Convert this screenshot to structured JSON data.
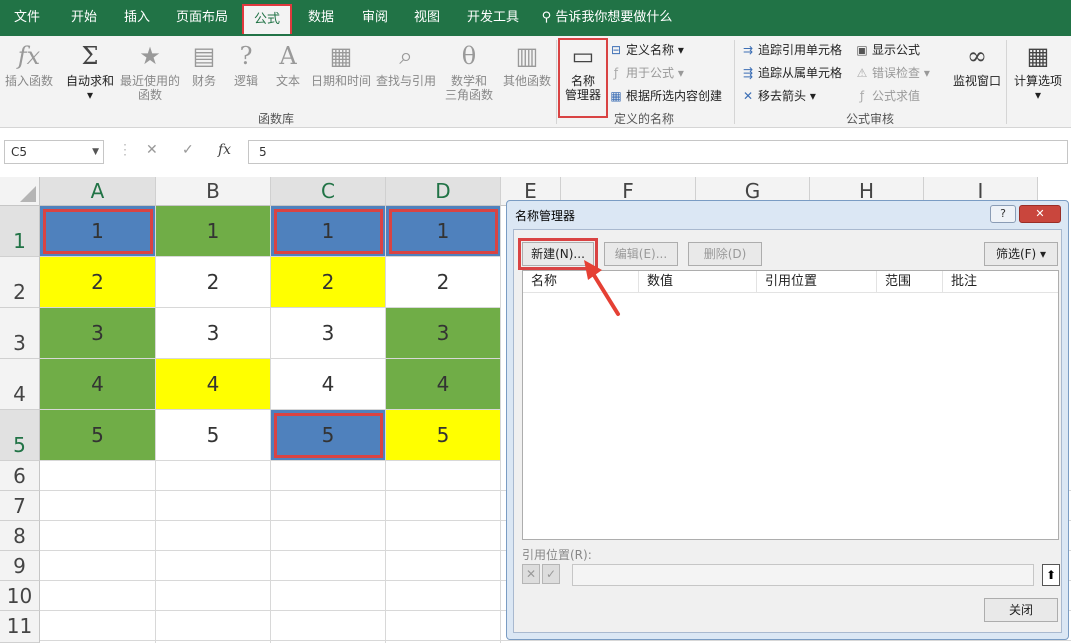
{
  "tabs": [
    "文件",
    "开始",
    "插入",
    "页面布局",
    "公式",
    "数据",
    "审阅",
    "视图",
    "开发工具"
  ],
  "tell_me": "告诉我你想要做什么",
  "ribbon": {
    "function_library": {
      "group_label": "函数库",
      "insert_function": "插入函数",
      "autosum": "自动求和",
      "recent": "最近使用的\n函数",
      "financial": "财务",
      "logical": "逻辑",
      "text": "文本",
      "datetime": "日期和时间",
      "lookup": "查找与引用",
      "math_l1": "数学和",
      "math_l2": "三角函数",
      "more": "其他函数"
    },
    "defined_names": {
      "group_label": "定义的名称",
      "name_manager_l1": "名称",
      "name_manager_l2": "管理器",
      "define_name": "定义名称",
      "use_in_formula": "用于公式",
      "create_from_selection": "根据所选内容创建"
    },
    "formula_auditing": {
      "group_label": "公式审核",
      "trace_precedents": "追踪引用单元格",
      "trace_dependents": "追踪从属单元格",
      "remove_arrows": "移去箭头",
      "show_formulas": "显示公式",
      "error_checking": "错误检查",
      "evaluate_formula": "公式求值"
    },
    "watch_window": "监视窗口",
    "calc_options": "计算选项"
  },
  "formula_bar": {
    "name_box": "C5",
    "fx": "fx",
    "value": "5"
  },
  "columns": [
    "A",
    "B",
    "C",
    "D",
    "E",
    "F",
    "G",
    "H",
    "I"
  ],
  "rows": [
    "1",
    "2",
    "3",
    "4",
    "5",
    "6",
    "7",
    "8",
    "9",
    "10",
    "11"
  ],
  "cells": [
    [
      "1",
      "1",
      "1",
      "1"
    ],
    [
      "2",
      "2",
      "2",
      "2"
    ],
    [
      "3",
      "3",
      "3",
      "3"
    ],
    [
      "4",
      "4",
      "4",
      "4"
    ],
    [
      "5",
      "5",
      "5",
      "5"
    ]
  ],
  "colors": {
    "green": "#70ad47",
    "yellow": "#ffff00",
    "blue": "#4f81bd",
    "white": "#ffffff",
    "highlight": "#d94343"
  },
  "dialog": {
    "title": "名称管理器",
    "help": "?",
    "close_x": "✕",
    "new_btn": "新建(N)...",
    "edit_btn": "编辑(E)...",
    "delete_btn": "删除(D)",
    "filter_btn": "筛选(F) ▾",
    "columns": [
      "名称",
      "数值",
      "引用位置",
      "范围",
      "批注"
    ],
    "refers_to_label": "引用位置(R):",
    "close_btn": "关闭"
  }
}
